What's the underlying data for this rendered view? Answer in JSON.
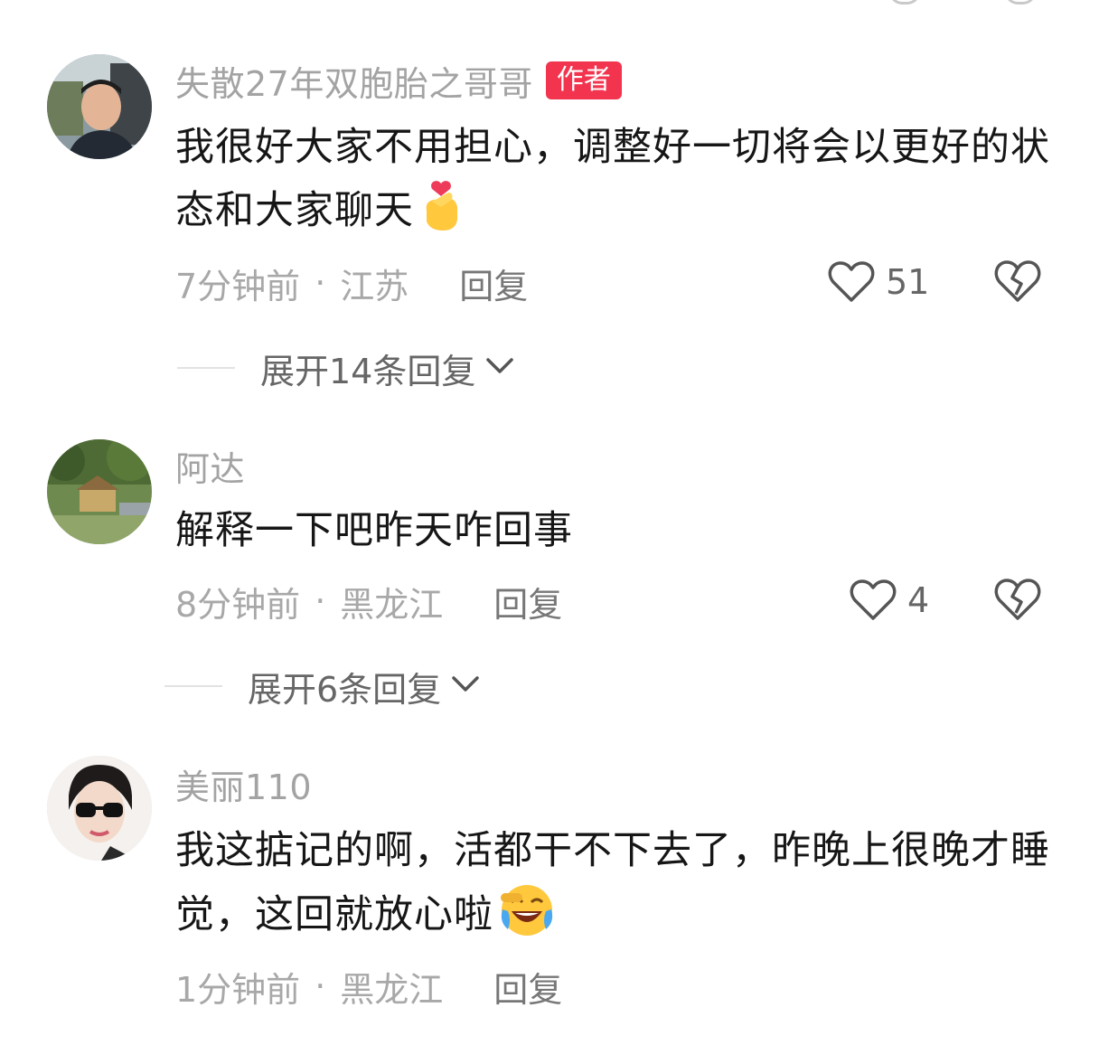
{
  "colors": {
    "username": "#a3a3a3",
    "text": "#161616",
    "meta": "#a8a8a8",
    "badge_bg": "#f2344f",
    "action": "#666666"
  },
  "comments": [
    {
      "username": "失散27年双胞胎之哥哥",
      "badge": "作者",
      "text": "我很好大家不用担心，调整好一切将会以更好的状态和大家聊天",
      "emoji": "finger-heart-emoji",
      "time": "7分钟前",
      "location": "江苏",
      "reply_label": "回复",
      "likes": "51",
      "expand_label": "展开14条回复"
    },
    {
      "username": "阿达",
      "text": "解释一下吧昨天咋回事",
      "time": "8分钟前",
      "location": "黑龙江",
      "reply_label": "回复",
      "likes": "4",
      "expand_label": "展开6条回复"
    },
    {
      "username": "美丽110",
      "text": "我这掂记的啊，活都干不下去了，昨晚上很晚才睡觉，这回就放心啦",
      "emoji": "laughing-crying-emoji",
      "time": "1分钟前",
      "location": "黑龙江",
      "reply_label": "回复"
    }
  ],
  "separator": "·"
}
